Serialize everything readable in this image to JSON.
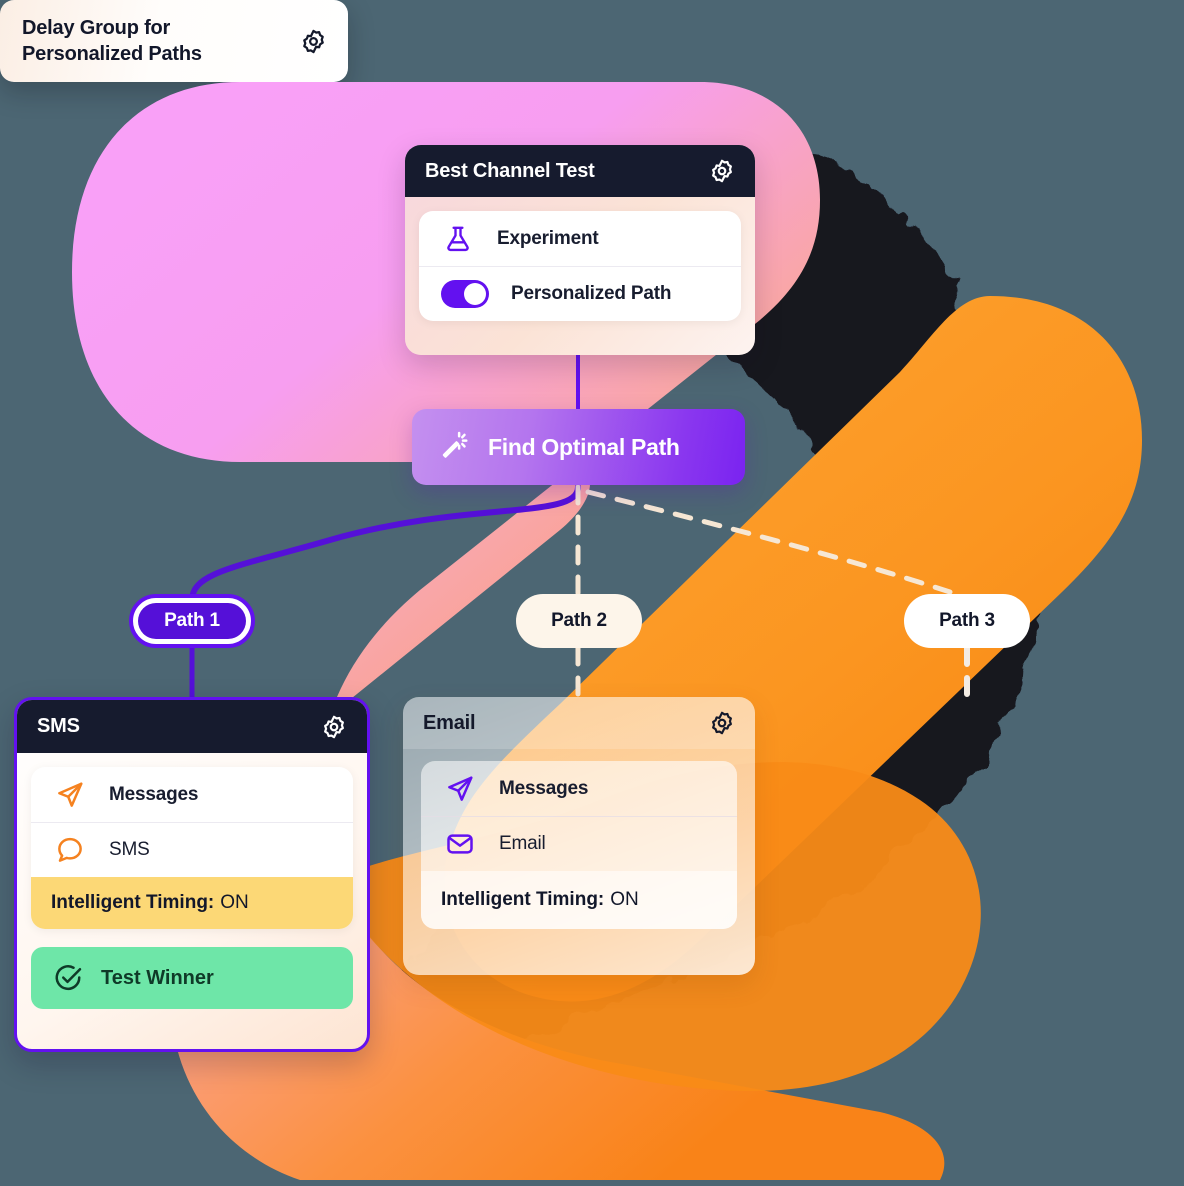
{
  "theme": {
    "page_background": "#4c6673",
    "accent_purple": "#6311f0",
    "accent_purple_dark": "#5510d8",
    "header_navy": "#161b2e",
    "timing_yellow": "#fcd876",
    "winner_green": "#6ee6a8",
    "orange_icon": "#f58220",
    "cream_pill": "#fdf5ea"
  },
  "best_channel_card": {
    "title": "Best Channel Test",
    "gear_icon": "gear-icon",
    "rows": [
      {
        "icon": "flask-icon",
        "label": "Experiment"
      },
      {
        "icon": "toggle-icon",
        "label": "Personalized Path",
        "toggle_state": "on"
      }
    ]
  },
  "find_optimal_button": {
    "label": "Find Optimal Path",
    "icon": "magic-wand-icon"
  },
  "paths": [
    {
      "label": "Path 1",
      "style": "active"
    },
    {
      "label": "Path 2",
      "style": "cream"
    },
    {
      "label": "Path 3",
      "style": "white"
    }
  ],
  "sms_card": {
    "title": "SMS",
    "gear_icon": "gear-icon",
    "rows": [
      {
        "icon": "paper-plane-icon",
        "label": "Messages"
      },
      {
        "icon": "chat-bubble-icon",
        "label": "SMS"
      }
    ],
    "timing_label": "Intelligent Timing:",
    "timing_value": "ON",
    "winner_label": "Test Winner",
    "winner_icon": "check-circle-icon"
  },
  "email_card": {
    "title": "Email",
    "gear_icon": "gear-icon",
    "rows": [
      {
        "icon": "paper-plane-icon",
        "label": "Messages"
      },
      {
        "icon": "envelope-icon",
        "label": "Email"
      }
    ],
    "timing_label": "Intelligent Timing:",
    "timing_value": "ON"
  },
  "delay_card": {
    "title_line1": "Delay Group for",
    "title_line2": "Personalized Paths",
    "gear_icon": "gear-icon"
  }
}
